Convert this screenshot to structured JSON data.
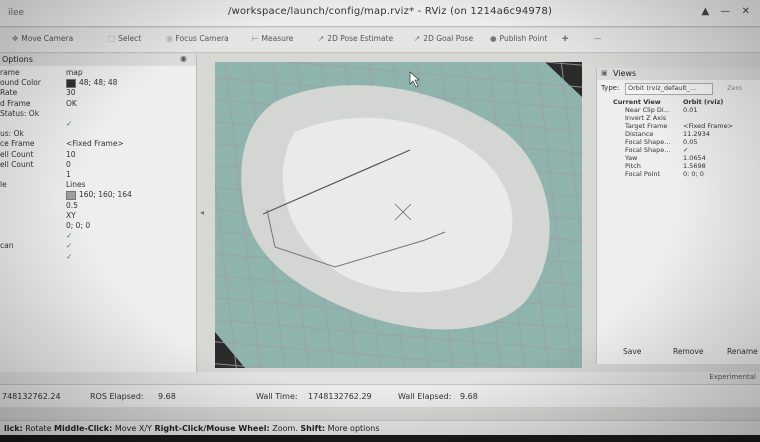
{
  "window": {
    "app_label": "ilee",
    "title": "/workspace/launch/config/map.rviz* - RViz (on 1214a6c94978)"
  },
  "toolbar": {
    "tools": [
      {
        "label": "Move Camera",
        "icon": "move-camera-icon"
      },
      {
        "label": "Select",
        "icon": "select-icon"
      },
      {
        "label": "Focus Camera",
        "icon": "focus-camera-icon"
      },
      {
        "label": "Measure",
        "icon": "measure-icon"
      },
      {
        "label": "2D Pose Estimate",
        "icon": "pose-estimate-icon"
      },
      {
        "label": "2D Goal Pose",
        "icon": "goal-pose-icon"
      },
      {
        "label": "Publish Point",
        "icon": "publish-point-icon"
      }
    ]
  },
  "left_panel": {
    "header": "Options",
    "rows": [
      {
        "key": "rame",
        "value": "map"
      },
      {
        "key": "ound Color",
        "value": "48; 48; 48"
      },
      {
        "key": "Rate",
        "value": "30"
      },
      {
        "key": "d Frame",
        "value": "OK"
      },
      {
        "key": "Status: Ok",
        "value": ""
      },
      {
        "key": "",
        "value": "✓"
      },
      {
        "key": "us: Ok",
        "value": ""
      },
      {
        "key": "ce Frame",
        "value": "<Fixed Frame>"
      },
      {
        "key": "ell Count",
        "value": "10"
      },
      {
        "key": "ell Count",
        "value": "0"
      },
      {
        "key": "",
        "value": "1"
      },
      {
        "key": "le",
        "value": "Lines"
      },
      {
        "key": "",
        "value": "160; 160; 164"
      },
      {
        "key": "",
        "value": "0.5"
      },
      {
        "key": "",
        "value": "XY"
      },
      {
        "key": "",
        "value": "0; 0; 0"
      },
      {
        "key": "",
        "value": "✓"
      },
      {
        "key": "can",
        "value": "✓"
      },
      {
        "key": "",
        "value": "✓"
      }
    ]
  },
  "views_panel": {
    "header": "Views",
    "type_label": "Type:",
    "type_value": "Orbit (rviz_default_...",
    "zero_label": "Zero",
    "rows": [
      {
        "key": "Current View",
        "value": "Orbit (rviz)",
        "indent": 0,
        "bold": true
      },
      {
        "key": "Near Clip Di...",
        "value": "0.01",
        "indent": 1
      },
      {
        "key": "Invert Z Axis",
        "value": "",
        "indent": 1
      },
      {
        "key": "Target Frame",
        "value": "<Fixed Frame>",
        "indent": 1
      },
      {
        "key": "Distance",
        "value": "11.2934",
        "indent": 1
      },
      {
        "key": "Focal Shape...",
        "value": "0.05",
        "indent": 1
      },
      {
        "key": "Focal Shape...",
        "value": "✓",
        "indent": 1
      },
      {
        "key": "Yaw",
        "value": "1.0654",
        "indent": 1
      },
      {
        "key": "Pitch",
        "value": "1.5698",
        "indent": 1
      },
      {
        "key": "Focal Point",
        "value": "0; 0; 0",
        "indent": 1
      }
    ],
    "buttons": [
      "Save",
      "Remove",
      "Rename"
    ]
  },
  "experimental_label": "Experimental",
  "time_panel": {
    "ros_time_partial": "748132762.24",
    "ros_elapsed_label": "ROS Elapsed:",
    "ros_elapsed_value": "9.68",
    "wall_time_label": "Wall Time:",
    "wall_time_value": "1748132762.29",
    "wall_elapsed_label": "Wall Elapsed:",
    "wall_elapsed_value": "9.68"
  },
  "status_bar": {
    "left_click_partial": "lick:",
    "left_click_action": "Rotate",
    "middle_click_label": "Middle-Click:",
    "middle_click_action": "Move X/Y",
    "right_click_label": "Right-Click/Mouse Wheel:",
    "right_click_action": "Zoom.",
    "shift_label": "Shift:",
    "shift_action": "More options"
  },
  "colors": {
    "grid_background": "#8fb3ad",
    "grid_lines": "#a0a0a4",
    "map_free": "#d9d9d6",
    "viewport_bg": "#2b2b2b"
  }
}
